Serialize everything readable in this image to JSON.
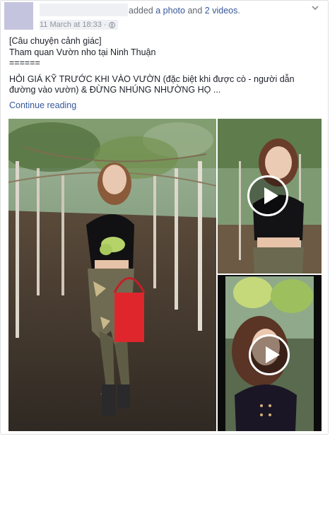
{
  "post": {
    "headline_prefix": "added",
    "headline_photo": "a photo",
    "headline_and": "and",
    "headline_videos": "2 videos",
    "headline_end": ".",
    "timestamp": "11 March at 18:33",
    "separator": "·",
    "icons": {
      "privacy": "globe-icon",
      "menu": "chevron-down-icon",
      "play": "play-icon"
    },
    "lines": [
      "[Câu chuyện cảnh giác]",
      "Tham quan Vườn nho tại Ninh Thuận",
      "======",
      "HỎI GIÁ KỸ TRƯỚC KHI VÀO VƯỜN (đặc biệt khi được cò - người dẫn đường vào vườn) & ĐỪNG NHÚNG NHƯỜNG HỌ ..."
    ],
    "continue_label": "Continue reading"
  },
  "colors": {
    "link": "#365899",
    "text": "#1d2129",
    "muted": "#90949c",
    "avatar": "#c5c4de"
  }
}
